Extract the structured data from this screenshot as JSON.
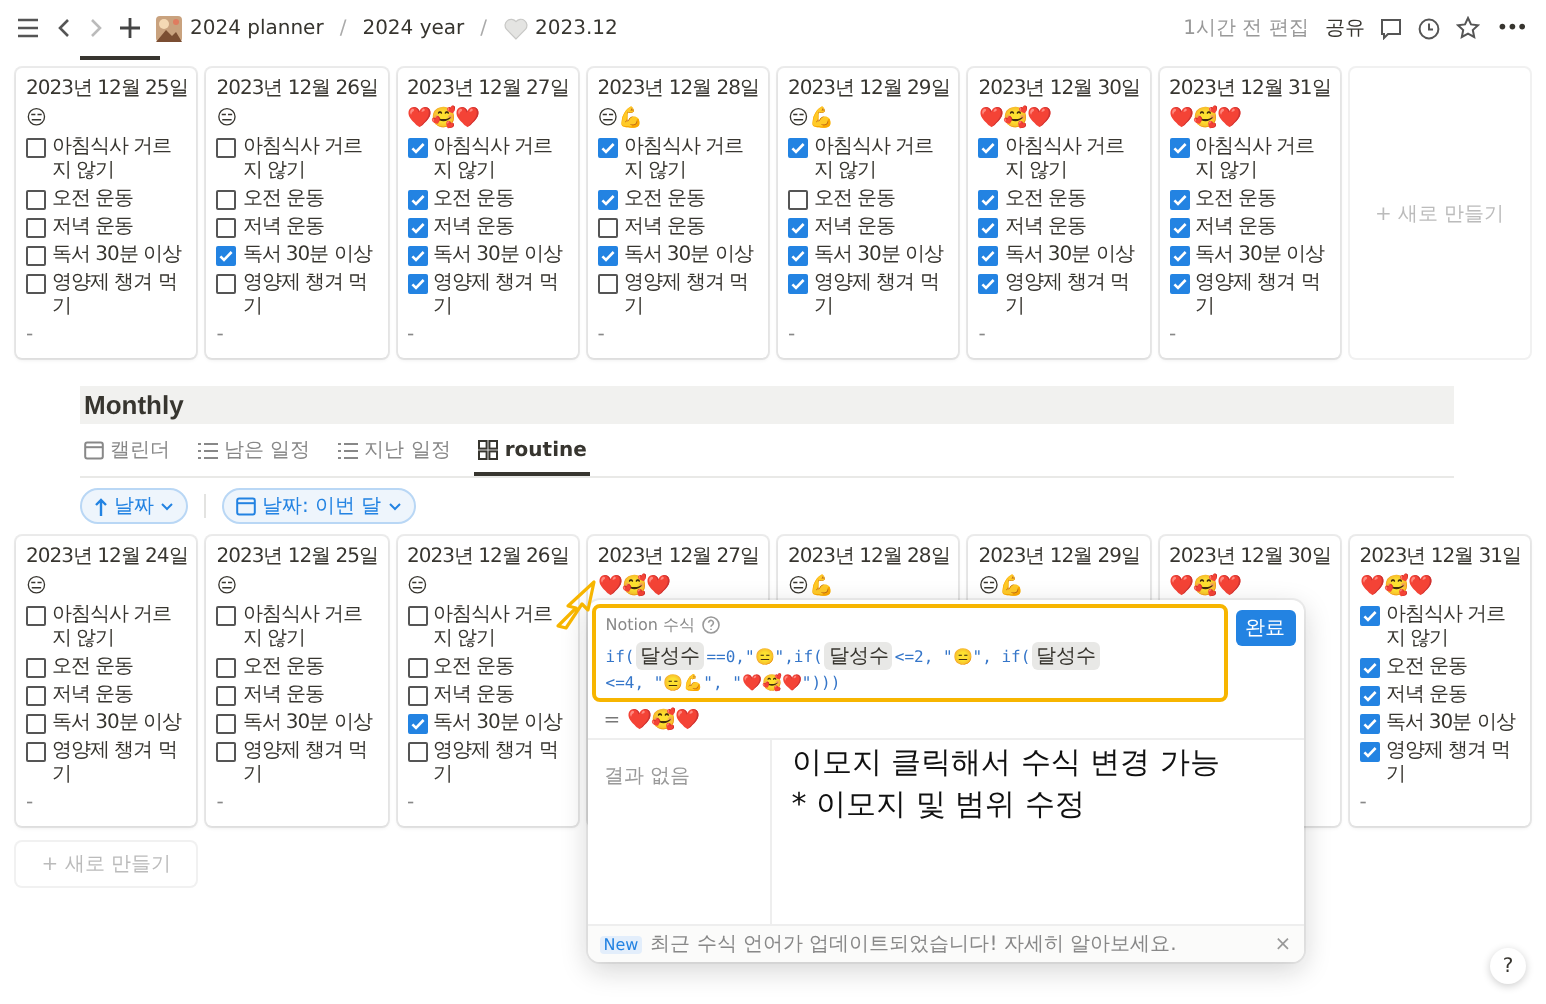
{
  "topbar": {
    "breadcrumbs": [
      {
        "label": "2024 planner"
      },
      {
        "label": "2024 year"
      },
      {
        "label": "2023.12"
      }
    ],
    "separator": "/",
    "edited": "1시간 전 편집",
    "share": "공유",
    "more": "•••"
  },
  "top_board": {
    "cards": [
      {
        "date": "2023년 12월 25일",
        "emoji": "😑",
        "items": [
          {
            "label": "아침식사 거르지 않기",
            "checked": false
          },
          {
            "label": "오전 운동",
            "checked": false
          },
          {
            "label": "저녁 운동",
            "checked": false
          },
          {
            "label": "독서 30분 이상",
            "checked": false
          },
          {
            "label": "영양제 챙겨 먹기",
            "checked": false
          }
        ],
        "footer": "-"
      },
      {
        "date": "2023년 12월 26일",
        "emoji": "😑",
        "items": [
          {
            "label": "아침식사 거르지 않기",
            "checked": false
          },
          {
            "label": "오전 운동",
            "checked": false
          },
          {
            "label": "저녁 운동",
            "checked": false
          },
          {
            "label": "독서 30분 이상",
            "checked": true
          },
          {
            "label": "영양제 챙겨 먹기",
            "checked": false
          }
        ],
        "footer": "-"
      },
      {
        "date": "2023년 12월 27일",
        "emoji": "❤️🥰❤️",
        "items": [
          {
            "label": "아침식사 거르지 않기",
            "checked": true
          },
          {
            "label": "오전 운동",
            "checked": true
          },
          {
            "label": "저녁 운동",
            "checked": true
          },
          {
            "label": "독서 30분 이상",
            "checked": true
          },
          {
            "label": "영양제 챙겨 먹기",
            "checked": true
          }
        ],
        "footer": "-"
      },
      {
        "date": "2023년 12월 28일",
        "emoji": "😑💪",
        "items": [
          {
            "label": "아침식사 거르지 않기",
            "checked": true
          },
          {
            "label": "오전 운동",
            "checked": true
          },
          {
            "label": "저녁 운동",
            "checked": false
          },
          {
            "label": "독서 30분 이상",
            "checked": true
          },
          {
            "label": "영양제 챙겨 먹기",
            "checked": false
          }
        ],
        "footer": "-"
      },
      {
        "date": "2023년 12월 29일",
        "emoji": "😑💪",
        "items": [
          {
            "label": "아침식사 거르지 않기",
            "checked": true
          },
          {
            "label": "오전 운동",
            "checked": false
          },
          {
            "label": "저녁 운동",
            "checked": true
          },
          {
            "label": "독서 30분 이상",
            "checked": true
          },
          {
            "label": "영양제 챙겨 먹기",
            "checked": true
          }
        ],
        "footer": "-"
      },
      {
        "date": "2023년 12월 30일",
        "emoji": "❤️🥰❤️",
        "items": [
          {
            "label": "아침식사 거르지 않기",
            "checked": true
          },
          {
            "label": "오전 운동",
            "checked": true
          },
          {
            "label": "저녁 운동",
            "checked": true
          },
          {
            "label": "독서 30분 이상",
            "checked": true
          },
          {
            "label": "영양제 챙겨 먹기",
            "checked": true
          }
        ],
        "footer": "-"
      },
      {
        "date": "2023년 12월 31일",
        "emoji": "❤️🥰❤️",
        "items": [
          {
            "label": "아침식사 거르지 않기",
            "checked": true
          },
          {
            "label": "오전 운동",
            "checked": true
          },
          {
            "label": "저녁 운동",
            "checked": true
          },
          {
            "label": "독서 30분 이상",
            "checked": true
          },
          {
            "label": "영양제 챙겨 먹기",
            "checked": true
          }
        ],
        "footer": "-"
      }
    ],
    "new_card": "+ 새로 만들기"
  },
  "section_title": "Monthly",
  "tabs": [
    {
      "label": "캘린더",
      "selected": false
    },
    {
      "label": "남은 일정",
      "selected": false
    },
    {
      "label": "지난 일정",
      "selected": false
    },
    {
      "label": "routine",
      "selected": true
    }
  ],
  "filters": [
    {
      "label": "날짜"
    },
    {
      "label": "날짜: 이번 달"
    }
  ],
  "bottom_board": {
    "cards": [
      {
        "date": "2023년 12월 24일",
        "emoji": "😑",
        "items": [
          {
            "label": "아침식사 거르지 않기",
            "checked": false
          },
          {
            "label": "오전 운동",
            "checked": false
          },
          {
            "label": "저녁 운동",
            "checked": false
          },
          {
            "label": "독서 30분 이상",
            "checked": false
          },
          {
            "label": "영양제 챙겨 먹기",
            "checked": false
          }
        ],
        "footer": "-"
      },
      {
        "date": "2023년 12월 25일",
        "emoji": "😑",
        "items": [
          {
            "label": "아침식사 거르지 않기",
            "checked": false
          },
          {
            "label": "오전 운동",
            "checked": false
          },
          {
            "label": "저녁 운동",
            "checked": false
          },
          {
            "label": "독서 30분 이상",
            "checked": false
          },
          {
            "label": "영양제 챙겨 먹기",
            "checked": false
          }
        ],
        "footer": "-"
      },
      {
        "date": "2023년 12월 26일",
        "emoji": "😑",
        "items": [
          {
            "label": "아침식사 거르지 않기",
            "checked": false
          },
          {
            "label": "오전 운동",
            "checked": false
          },
          {
            "label": "저녁 운동",
            "checked": false
          },
          {
            "label": "독서 30분 이상",
            "checked": true
          },
          {
            "label": "영양제 챙겨 먹기",
            "checked": false
          }
        ],
        "footer": "-"
      },
      {
        "date": "2023년 12월 27일",
        "emoji": "❤️🥰❤️"
      },
      {
        "date": "2023년 12월 28일",
        "emoji": "😑💪"
      },
      {
        "date": "2023년 12월 29일",
        "emoji": "😑💪"
      },
      {
        "date": "2023년 12월 30일",
        "emoji": "❤️🥰❤️"
      },
      {
        "date": "2023년 12월 31일",
        "emoji": "❤️🥰❤️",
        "items": [
          {
            "label": "아침식사 거르지 않기",
            "checked": true
          },
          {
            "label": "오전 운동",
            "checked": true
          },
          {
            "label": "저녁 운동",
            "checked": true
          },
          {
            "label": "독서 30분 이상",
            "checked": true
          },
          {
            "label": "영양제 챙겨 먹기",
            "checked": true
          }
        ],
        "footer": "-"
      }
    ],
    "new_card": "+ 새로 만들기"
  },
  "formula_popup": {
    "title": "Notion 수식",
    "done": "완료",
    "tokens": [
      {
        "kind": "code",
        "text": "if("
      },
      {
        "kind": "prop",
        "text": "달성수"
      },
      {
        "kind": "code",
        "text": "==0,\"😑\",if("
      },
      {
        "kind": "prop",
        "text": "달성수"
      },
      {
        "kind": "code",
        "text": "<=2, \"😑\", if("
      },
      {
        "kind": "prop",
        "text": "달성수"
      },
      {
        "kind": "code",
        "text": "<=4, \"😑💪\", \"❤️🥰❤️\")))"
      }
    ],
    "result": "= ❤️🥰❤️",
    "empty": "결과 없음",
    "notice_badge": "New",
    "notice": "최근 수식 언어가 업데이트되었습니다! 자세히 알아보세요.",
    "close": "×"
  },
  "annotation": {
    "lines": [
      "이모지 클릭해서 수식 변경 가능",
      "* 이모지 및 범위 수정"
    ]
  },
  "help": "?"
}
